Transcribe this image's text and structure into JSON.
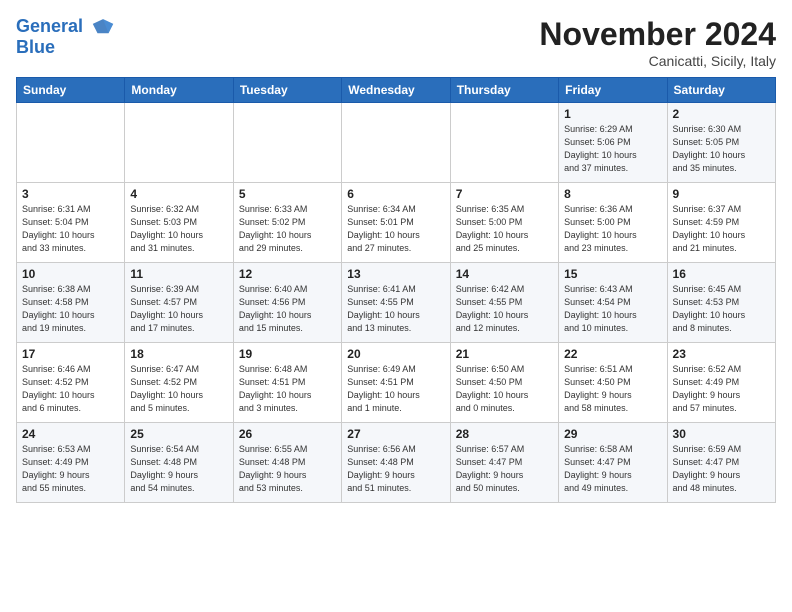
{
  "logo": {
    "line1": "General",
    "line2": "Blue"
  },
  "header": {
    "month": "November 2024",
    "location": "Canicatti, Sicily, Italy"
  },
  "weekdays": [
    "Sunday",
    "Monday",
    "Tuesday",
    "Wednesday",
    "Thursday",
    "Friday",
    "Saturday"
  ],
  "weeks": [
    [
      {
        "day": "",
        "info": ""
      },
      {
        "day": "",
        "info": ""
      },
      {
        "day": "",
        "info": ""
      },
      {
        "day": "",
        "info": ""
      },
      {
        "day": "",
        "info": ""
      },
      {
        "day": "1",
        "info": "Sunrise: 6:29 AM\nSunset: 5:06 PM\nDaylight: 10 hours\nand 37 minutes."
      },
      {
        "day": "2",
        "info": "Sunrise: 6:30 AM\nSunset: 5:05 PM\nDaylight: 10 hours\nand 35 minutes."
      }
    ],
    [
      {
        "day": "3",
        "info": "Sunrise: 6:31 AM\nSunset: 5:04 PM\nDaylight: 10 hours\nand 33 minutes."
      },
      {
        "day": "4",
        "info": "Sunrise: 6:32 AM\nSunset: 5:03 PM\nDaylight: 10 hours\nand 31 minutes."
      },
      {
        "day": "5",
        "info": "Sunrise: 6:33 AM\nSunset: 5:02 PM\nDaylight: 10 hours\nand 29 minutes."
      },
      {
        "day": "6",
        "info": "Sunrise: 6:34 AM\nSunset: 5:01 PM\nDaylight: 10 hours\nand 27 minutes."
      },
      {
        "day": "7",
        "info": "Sunrise: 6:35 AM\nSunset: 5:00 PM\nDaylight: 10 hours\nand 25 minutes."
      },
      {
        "day": "8",
        "info": "Sunrise: 6:36 AM\nSunset: 5:00 PM\nDaylight: 10 hours\nand 23 minutes."
      },
      {
        "day": "9",
        "info": "Sunrise: 6:37 AM\nSunset: 4:59 PM\nDaylight: 10 hours\nand 21 minutes."
      }
    ],
    [
      {
        "day": "10",
        "info": "Sunrise: 6:38 AM\nSunset: 4:58 PM\nDaylight: 10 hours\nand 19 minutes."
      },
      {
        "day": "11",
        "info": "Sunrise: 6:39 AM\nSunset: 4:57 PM\nDaylight: 10 hours\nand 17 minutes."
      },
      {
        "day": "12",
        "info": "Sunrise: 6:40 AM\nSunset: 4:56 PM\nDaylight: 10 hours\nand 15 minutes."
      },
      {
        "day": "13",
        "info": "Sunrise: 6:41 AM\nSunset: 4:55 PM\nDaylight: 10 hours\nand 13 minutes."
      },
      {
        "day": "14",
        "info": "Sunrise: 6:42 AM\nSunset: 4:55 PM\nDaylight: 10 hours\nand 12 minutes."
      },
      {
        "day": "15",
        "info": "Sunrise: 6:43 AM\nSunset: 4:54 PM\nDaylight: 10 hours\nand 10 minutes."
      },
      {
        "day": "16",
        "info": "Sunrise: 6:45 AM\nSunset: 4:53 PM\nDaylight: 10 hours\nand 8 minutes."
      }
    ],
    [
      {
        "day": "17",
        "info": "Sunrise: 6:46 AM\nSunset: 4:52 PM\nDaylight: 10 hours\nand 6 minutes."
      },
      {
        "day": "18",
        "info": "Sunrise: 6:47 AM\nSunset: 4:52 PM\nDaylight: 10 hours\nand 5 minutes."
      },
      {
        "day": "19",
        "info": "Sunrise: 6:48 AM\nSunset: 4:51 PM\nDaylight: 10 hours\nand 3 minutes."
      },
      {
        "day": "20",
        "info": "Sunrise: 6:49 AM\nSunset: 4:51 PM\nDaylight: 10 hours\nand 1 minute."
      },
      {
        "day": "21",
        "info": "Sunrise: 6:50 AM\nSunset: 4:50 PM\nDaylight: 10 hours\nand 0 minutes."
      },
      {
        "day": "22",
        "info": "Sunrise: 6:51 AM\nSunset: 4:50 PM\nDaylight: 9 hours\nand 58 minutes."
      },
      {
        "day": "23",
        "info": "Sunrise: 6:52 AM\nSunset: 4:49 PM\nDaylight: 9 hours\nand 57 minutes."
      }
    ],
    [
      {
        "day": "24",
        "info": "Sunrise: 6:53 AM\nSunset: 4:49 PM\nDaylight: 9 hours\nand 55 minutes."
      },
      {
        "day": "25",
        "info": "Sunrise: 6:54 AM\nSunset: 4:48 PM\nDaylight: 9 hours\nand 54 minutes."
      },
      {
        "day": "26",
        "info": "Sunrise: 6:55 AM\nSunset: 4:48 PM\nDaylight: 9 hours\nand 53 minutes."
      },
      {
        "day": "27",
        "info": "Sunrise: 6:56 AM\nSunset: 4:48 PM\nDaylight: 9 hours\nand 51 minutes."
      },
      {
        "day": "28",
        "info": "Sunrise: 6:57 AM\nSunset: 4:47 PM\nDaylight: 9 hours\nand 50 minutes."
      },
      {
        "day": "29",
        "info": "Sunrise: 6:58 AM\nSunset: 4:47 PM\nDaylight: 9 hours\nand 49 minutes."
      },
      {
        "day": "30",
        "info": "Sunrise: 6:59 AM\nSunset: 4:47 PM\nDaylight: 9 hours\nand 48 minutes."
      }
    ]
  ]
}
